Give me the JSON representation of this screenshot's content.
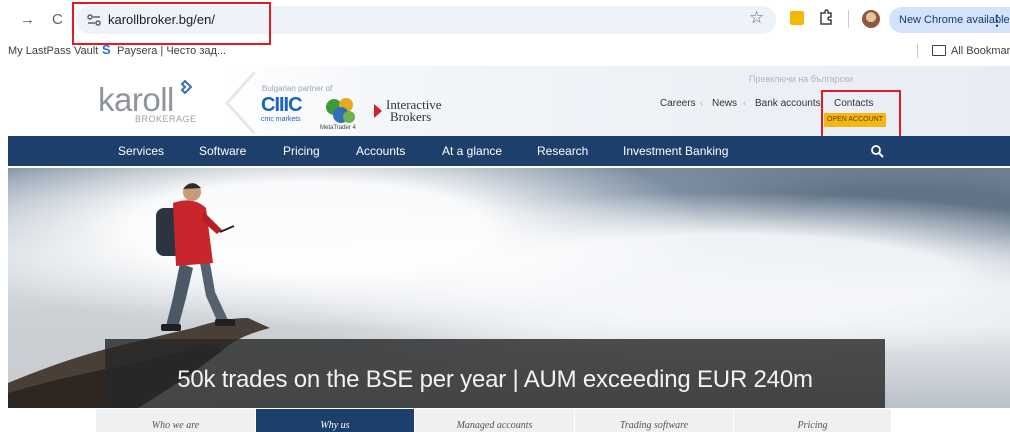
{
  "browser": {
    "url": "karollbroker.bg/en/",
    "new_chrome_label": "New Chrome available",
    "kebab_label": "⋮",
    "back_glyph": "→",
    "reload_glyph": "C",
    "star_glyph": "☆",
    "bookmarks": [
      {
        "label": "My LastPass Vault"
      },
      {
        "label": "Paysera | Често зад..."
      }
    ],
    "all_bookmarks_label": "All Bookmarks"
  },
  "site": {
    "logo_text": "karoll",
    "logo_sub": "BROKERAGE",
    "partner_label": "Bulgarian partner of",
    "cmc_big": "CIIIC",
    "cmc_small": "cmc markets",
    "mt4_label": "MetaTrader 4",
    "ib_line1": "Interactive",
    "ib_line2": "Brokers",
    "lang_switch": "Превключи на български",
    "top_links": [
      "Careers",
      "News",
      "Bank accounts",
      "Contacts"
    ],
    "open_account_label": "OPEN ACCOUNT",
    "nav": [
      "Services",
      "Software",
      "Pricing",
      "Accounts",
      "At a glance",
      "Research",
      "Investment Banking"
    ],
    "hero_caption": "50k trades on the BSE per year | AUM exceeding EUR 240m",
    "subtabs": [
      {
        "label": "Who we are",
        "active": false
      },
      {
        "label": "Why us",
        "active": true
      },
      {
        "label": "Managed accounts",
        "active": false
      },
      {
        "label": "Trading software",
        "active": false
      },
      {
        "label": "Pricing",
        "active": false
      }
    ]
  },
  "colors": {
    "nav_bg": "#1d3f6b",
    "open_account_bg": "#f5b70f",
    "highlight_box": "#e01b24",
    "new_chrome_bg": "#d3e3fd"
  }
}
